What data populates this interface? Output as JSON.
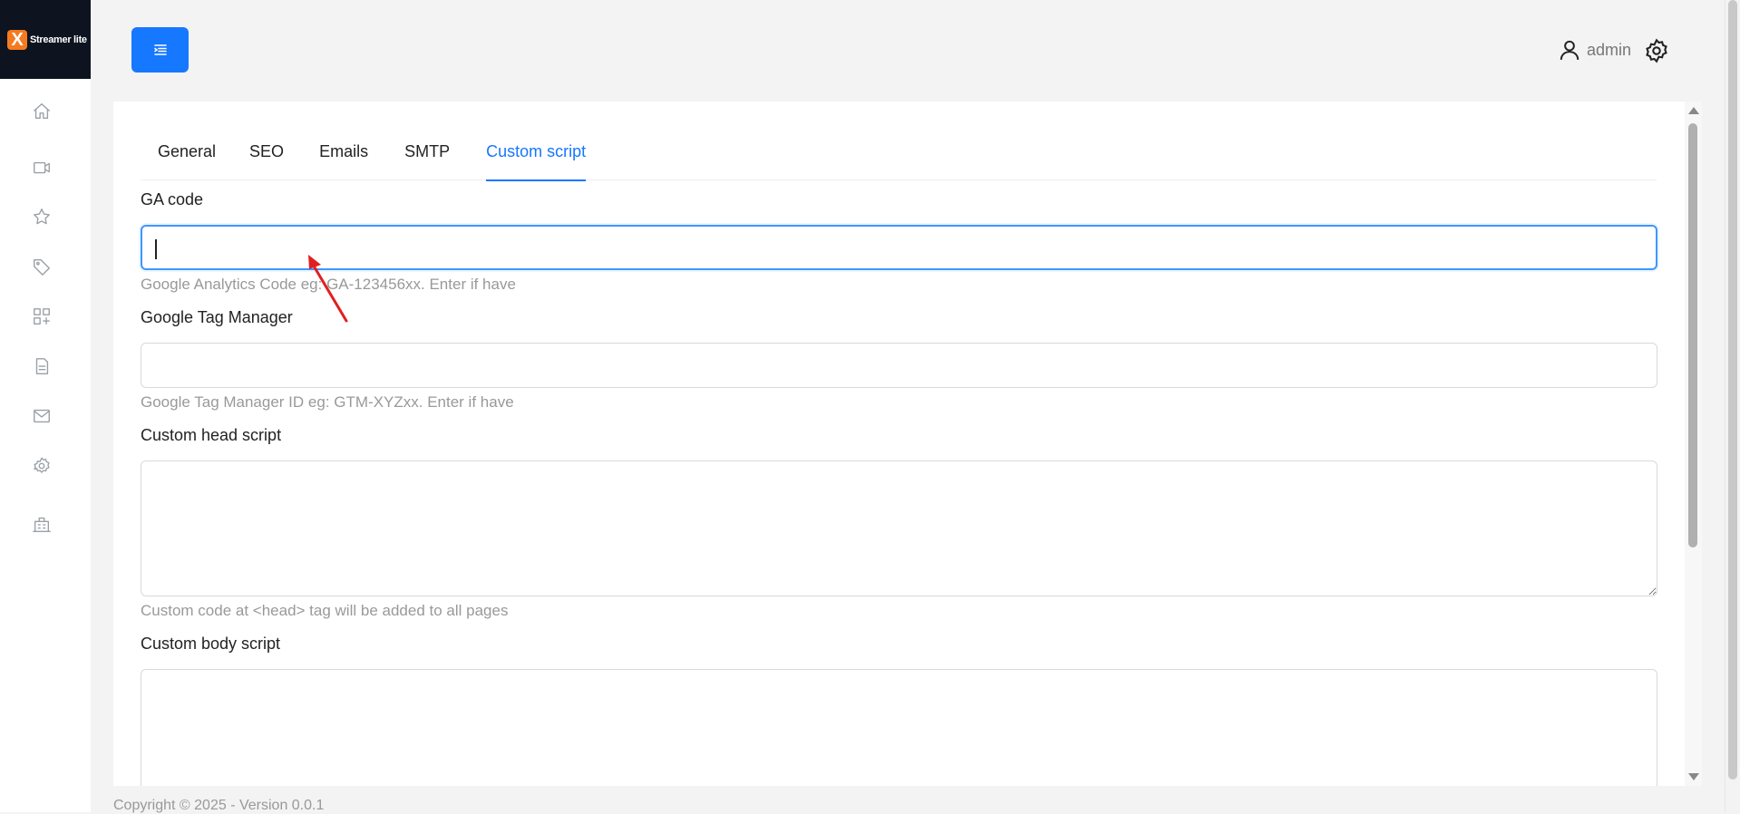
{
  "app": {
    "logo_mark": "X",
    "logo_text": "Streamer lite"
  },
  "sidebar": {
    "items": [
      {
        "icon": "home-icon"
      },
      {
        "icon": "video-icon"
      },
      {
        "icon": "star-icon"
      },
      {
        "icon": "tag-icon"
      },
      {
        "icon": "apps-icon"
      },
      {
        "icon": "file-icon"
      },
      {
        "icon": "mail-icon"
      },
      {
        "icon": "settings-icon"
      },
      {
        "icon": "building-icon"
      }
    ]
  },
  "header": {
    "user_name": "admin"
  },
  "tabs": [
    {
      "label": "General",
      "active": false
    },
    {
      "label": "SEO",
      "active": false
    },
    {
      "label": "Emails",
      "active": false
    },
    {
      "label": "SMTP",
      "active": false
    },
    {
      "label": "Custom script",
      "active": true
    }
  ],
  "form": {
    "ga_code": {
      "label": "GA code",
      "value": "",
      "help": "Google Analytics Code eg: GA-123456xx. Enter if have"
    },
    "gtm": {
      "label": "Google Tag Manager",
      "value": "",
      "help": "Google Tag Manager ID eg: GTM-XYZxx. Enter if have"
    },
    "head_script": {
      "label": "Custom head script",
      "value": "",
      "help": "Custom code at <head> tag will be added to all pages"
    },
    "body_script": {
      "label": "Custom body script",
      "value": ""
    }
  },
  "footer": {
    "text": "Copyright © 2025 - Version 0.0.1"
  },
  "colors": {
    "accent": "#1677ff",
    "logo_bg": "#0d1420",
    "logo_mark": "#f47b20",
    "annotation": "#e02020"
  }
}
